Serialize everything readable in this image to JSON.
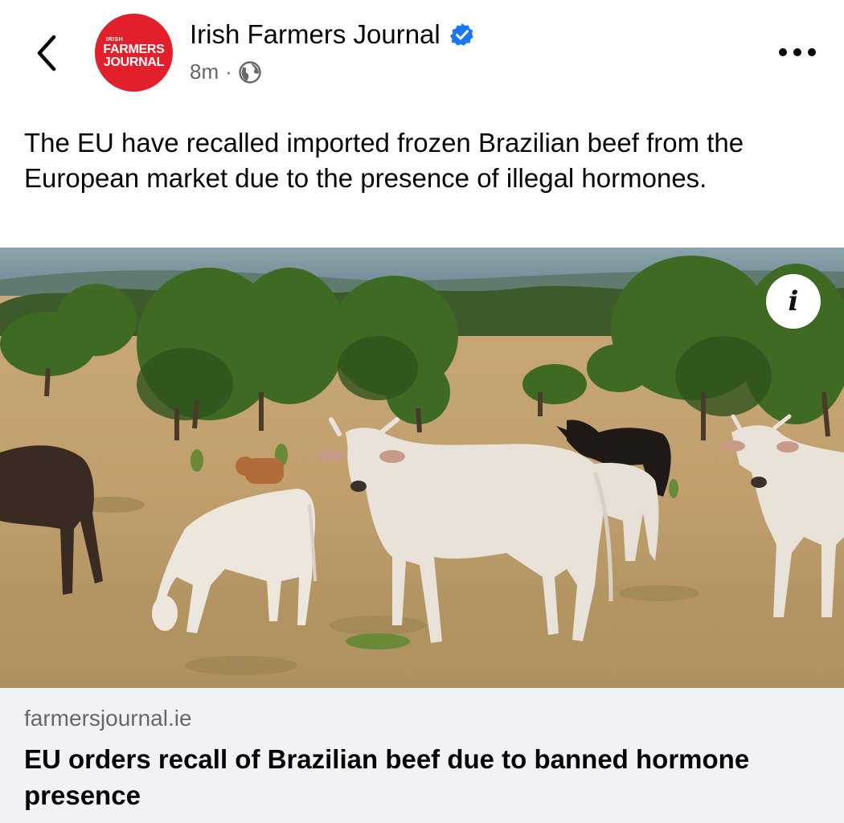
{
  "header": {
    "page_name": "Irish Farmers Journal",
    "time": "8m",
    "separator": "·",
    "audience_icon": "globe-icon",
    "verified_icon": "verified-badge-icon",
    "back_icon": "chevron-left-icon",
    "more_icon": "more-horizontal-icon",
    "avatar": {
      "line1": "IRISH",
      "line2": "FARMERS",
      "line3": "JOURNAL",
      "color": "#e2202c"
    }
  },
  "post": {
    "text": "The EU have recalled imported frozen Brazilian beef from the European market due to the presence of illegal hormones."
  },
  "photo": {
    "description_icon": "info-icon",
    "info_label": "i"
  },
  "link_preview": {
    "domain": "farmersjournal.ie",
    "headline": "EU orders recall of Brazilian beef due to banned hormone presence"
  },
  "colors": {
    "verified": "#1877f2",
    "secondary_text": "#65676b",
    "preview_bg": "#f0f2f5"
  }
}
